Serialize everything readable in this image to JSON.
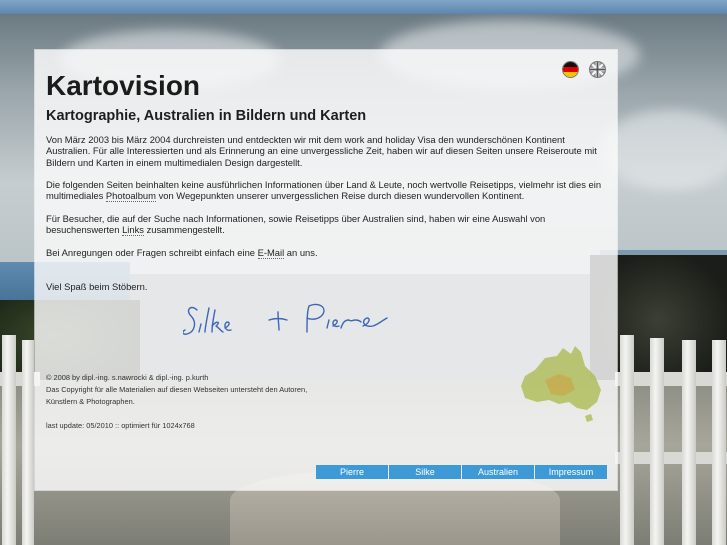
{
  "site": {
    "title": "Kartovision",
    "subtitle": "Kartographie, Australien in Bildern und Karten"
  },
  "intro": {
    "p1": "Von März 2003 bis März 2004 durchreisten und entdeckten wir mit dem work and holiday Visa den wunderschönen Kontinent Australien. Für alle Interessierten und als Erinnerung an eine unvergessliche Zeit, haben wir auf diesen Seiten unsere Reiseroute mit Bildern und Karten in einem multimedialen Design dargestellt.",
    "p2_before": "Die folgenden Seiten beinhalten keine ausführlichen Informationen über Land & Leute, noch wertvolle Reisetipps, vielmehr ist dies ein multimediales ",
    "p2_link": "Photoalbum",
    "p2_after": " von Wegepunkten unserer unvergesslichen Reise durch diesen wundervollen Kontinent.",
    "p3_before": "Für Besucher, die auf der Suche nach Informationen, sowie Reisetipps über Australien sind, haben wir eine Auswahl von besuchenswerten ",
    "p3_link": "Links",
    "p3_after": " zusammengestellt.",
    "p4_before": "Bei Anregungen oder Fragen schreibt einfach eine ",
    "p4_link": "E-Mail",
    "p4_after": " an uns.",
    "p5": "Viel Spaß beim Stöbern."
  },
  "signature": "Silke + Pierre",
  "footer": {
    "copyright": "© 2008 by dipl.-ing. s.nawrocki & dipl.-ing. p.kurth",
    "rights_line1": "Das Copyright für alle Materialien auf diesen Webseiten untersteht den Autoren,",
    "rights_line2": "Künstlern & Photographen.",
    "update": "last update: 05/2010 :: optimiert für 1024x768"
  },
  "nav": [
    "Pierre",
    "Silke",
    "Australien",
    "Impressum"
  ],
  "colors": {
    "accent": "#3d9ad6",
    "map_green": "#a8b84a",
    "map_ochre": "#c9a64a"
  }
}
